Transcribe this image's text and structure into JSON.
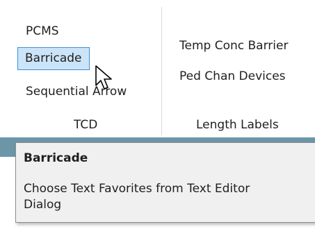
{
  "ribbon": {
    "groups": [
      {
        "label": "TCD",
        "buttons": [
          {
            "label": "PCMS"
          },
          {
            "label": "Barricade"
          },
          {
            "label": "Sequential Arrow"
          }
        ]
      },
      {
        "label": "Length Labels",
        "buttons": [
          {
            "label": "Temp Conc Barrier"
          },
          {
            "label": "Ped Chan Devices"
          }
        ]
      }
    ]
  },
  "tooltip": {
    "title": "Barricade",
    "description": "Choose Text Favorites from Text Editor Dialog"
  },
  "colors": {
    "hover_fill": "#cce4f7",
    "hover_border": "#3d8fd6",
    "band": "#6b96a8",
    "tooltip_bg": "#f0f0f0"
  },
  "icons": {
    "cursor": "arrow-pointer-icon"
  }
}
